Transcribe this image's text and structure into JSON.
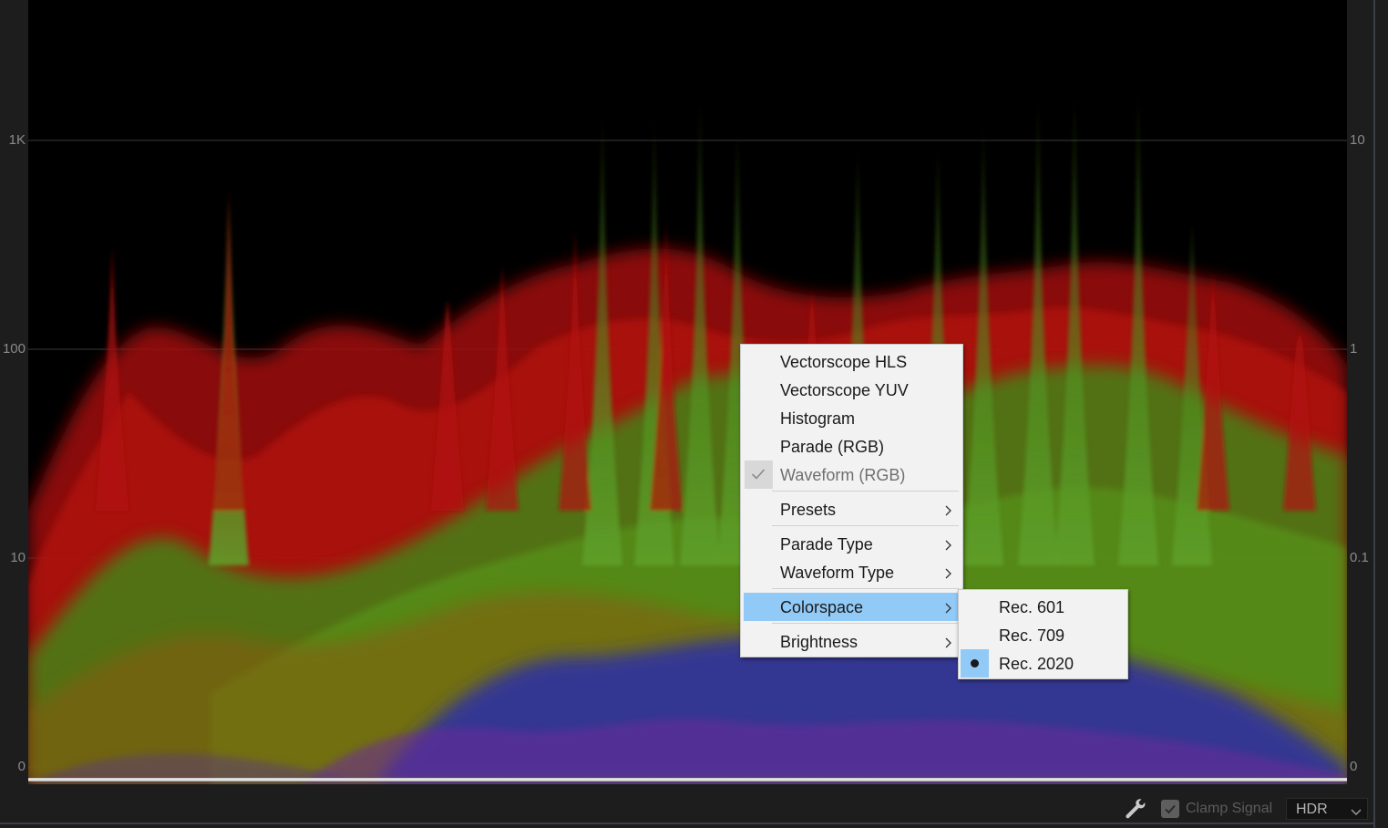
{
  "scope": {
    "left_axis": [
      "1K",
      "100",
      "10",
      "0"
    ],
    "right_axis": [
      "10",
      "1",
      "0.1",
      "0"
    ]
  },
  "context_menu": {
    "items": [
      {
        "label": "Vectorscope HLS"
      },
      {
        "label": "Vectorscope YUV"
      },
      {
        "label": "Histogram"
      },
      {
        "label": "Parade (RGB)"
      },
      {
        "label": "Waveform (RGB)",
        "checked": true,
        "disabled": true
      },
      {
        "label": "Presets",
        "submenu": true
      },
      {
        "label": "Parade Type",
        "submenu": true
      },
      {
        "label": "Waveform Type",
        "submenu": true
      },
      {
        "label": "Colorspace",
        "submenu": true,
        "highlighted": true
      },
      {
        "label": "Brightness",
        "submenu": true
      }
    ]
  },
  "colorspace_submenu": {
    "items": [
      {
        "label": "Rec. 601",
        "selected": false
      },
      {
        "label": "Rec. 709",
        "selected": false
      },
      {
        "label": "Rec. 2020",
        "selected": true
      }
    ]
  },
  "toolbar": {
    "wrench_icon": "wrench-icon",
    "clamp_signal_label": "Clamp Signal",
    "clamp_signal_checked": true,
    "mode_value": "HDR"
  },
  "colors": {
    "menu_highlight": "#91c9f7",
    "menu_bg": "#f2f2f2",
    "panel_bg": "#1d1d1d",
    "scope_bg": "#000000"
  }
}
